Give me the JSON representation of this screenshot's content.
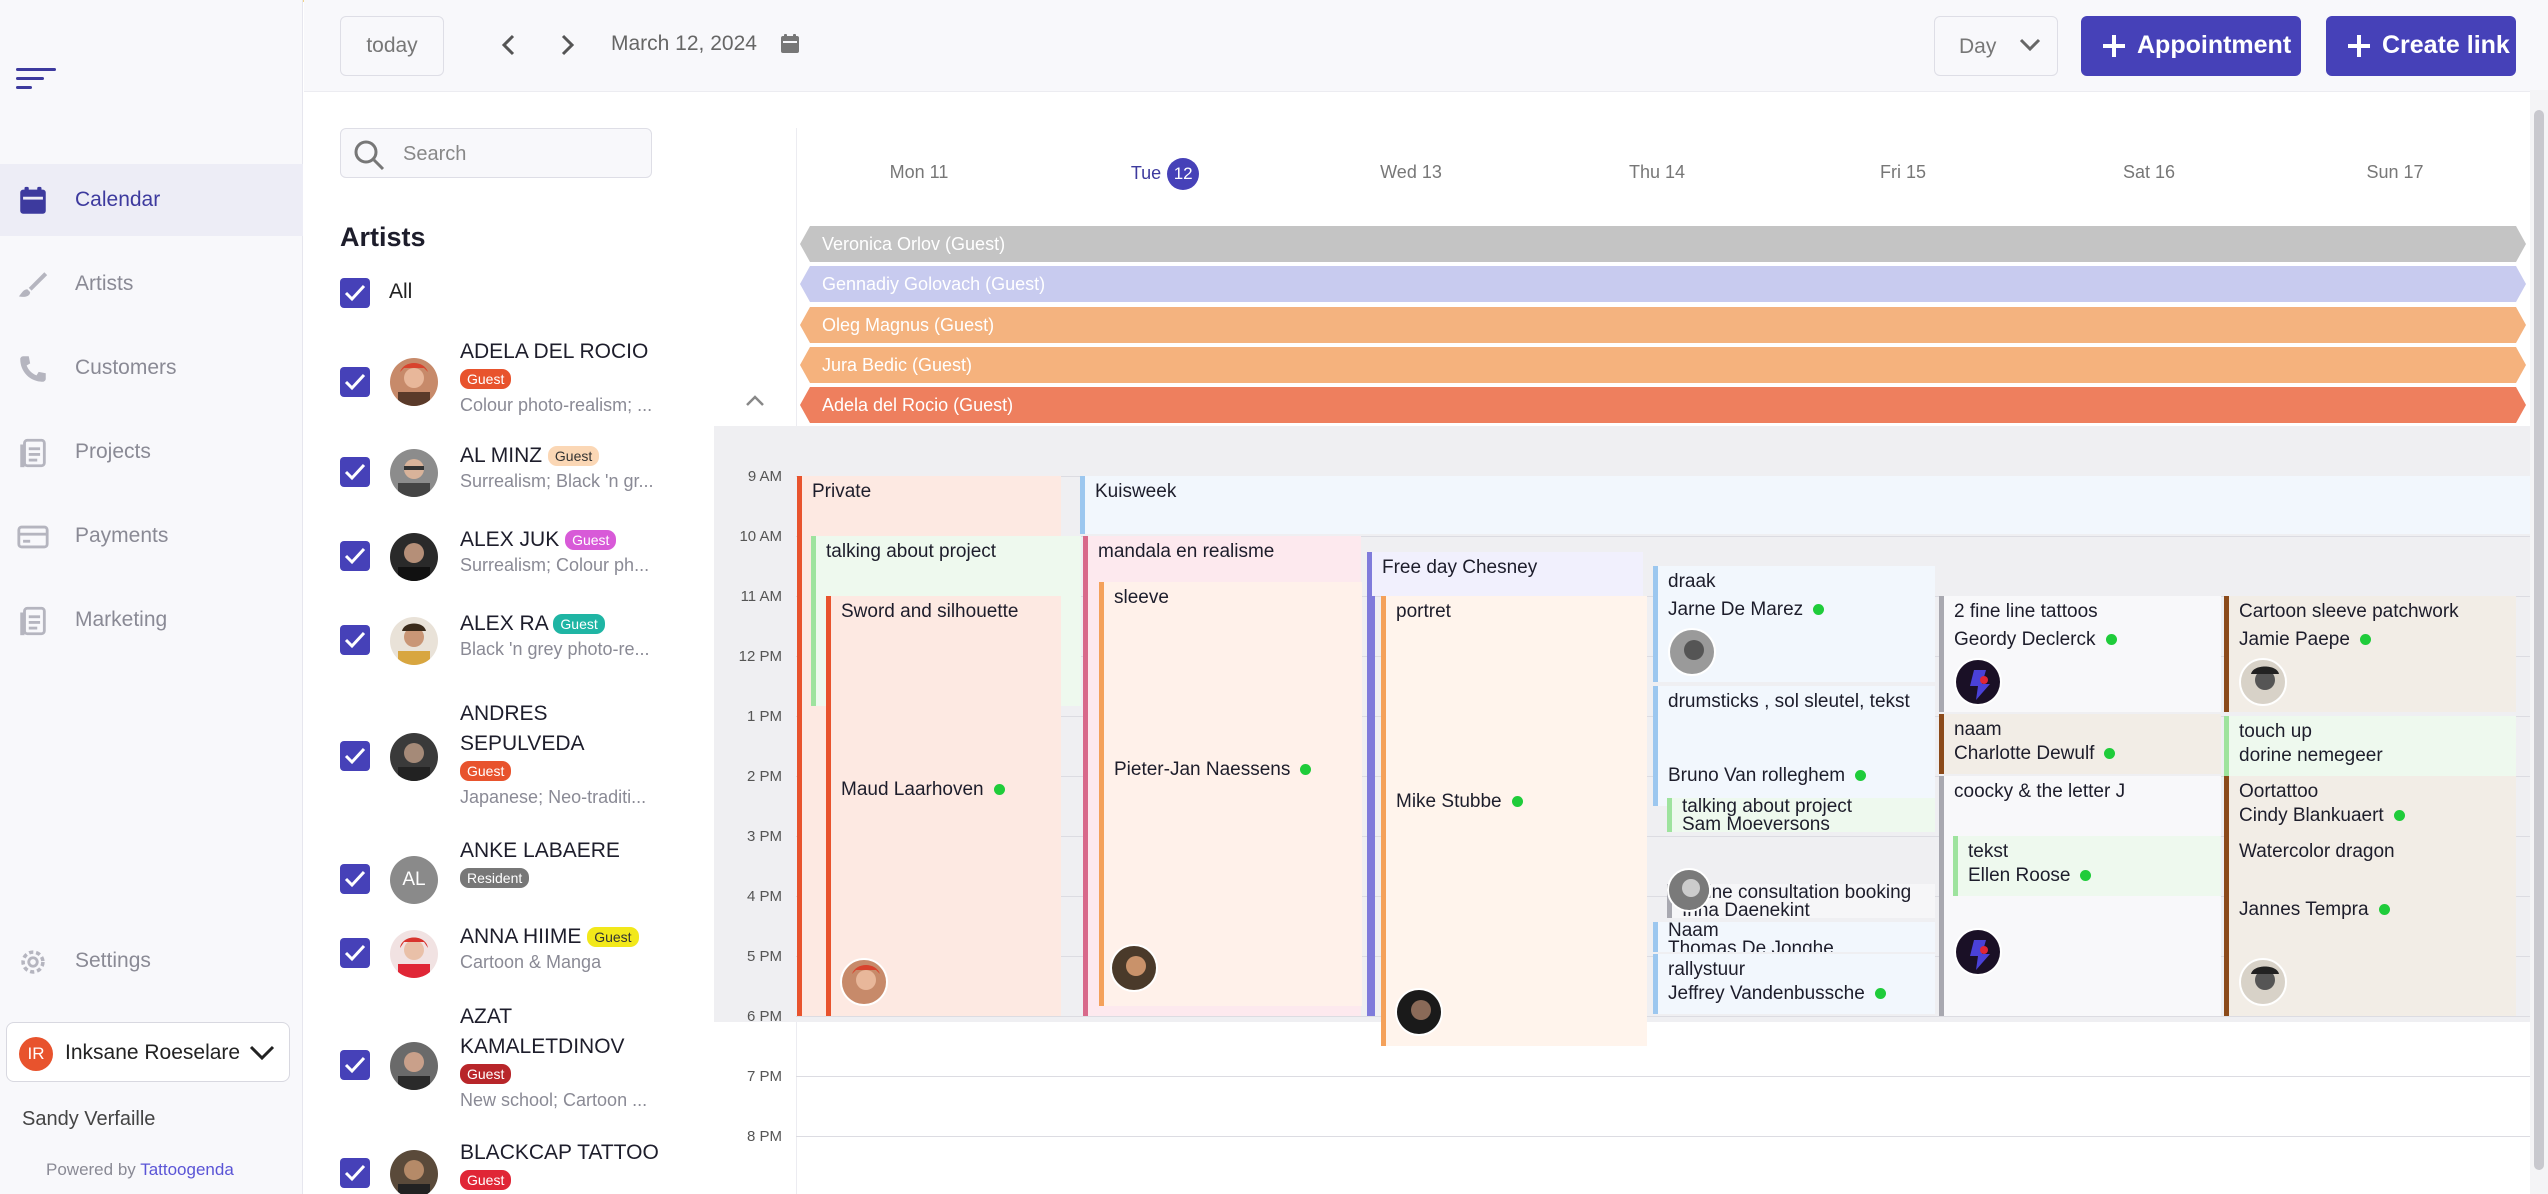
{
  "header": {
    "today_label": "today",
    "date": "March 12, 2024",
    "view": "Day",
    "appointment_label": "Appointment",
    "create_link_label": "Create link"
  },
  "sidebar": {
    "items": [
      {
        "label": "Calendar",
        "icon": "calendar-icon",
        "active": true
      },
      {
        "label": "Artists",
        "icon": "brush-icon"
      },
      {
        "label": "Customers",
        "icon": "phone-icon"
      },
      {
        "label": "Projects",
        "icon": "document-icon"
      },
      {
        "label": "Payments",
        "icon": "card-icon"
      },
      {
        "label": "Marketing",
        "icon": "document-icon"
      }
    ],
    "settings_label": "Settings",
    "studio_initials": "IR",
    "studio_name": "Inksane Roeselare",
    "user_name": "Sandy Verfaille",
    "powered_by": "Powered by",
    "brand": "Tattoogenda"
  },
  "artists": {
    "search_placeholder": "Search",
    "title": "Artists",
    "all_label": "All",
    "list": [
      {
        "name": "ADELA DEL ROCIO",
        "badge": "Guest",
        "badge_color": "#e8532d",
        "badge_text": "#ffffff",
        "styles": "Colour photo-realism; ..."
      },
      {
        "name": "AL MINZ",
        "badge": "Guest",
        "badge_color": "#fbd7b5",
        "badge_text": "#333333",
        "styles": "Surrealism; Black 'n gr..."
      },
      {
        "name": "ALEX JUK",
        "badge": "Guest",
        "badge_color": "#d85ad8",
        "badge_text": "#ffffff",
        "styles": "Surrealism; Colour ph..."
      },
      {
        "name": "ALEX RA",
        "badge": "Guest",
        "badge_color": "#1fb5a4",
        "badge_text": "#ffffff",
        "styles": "Black 'n grey photo-re..."
      },
      {
        "name_line1": "ANDRES",
        "name_line2": "SEPULVEDA",
        "badge": "Guest",
        "badge_color": "#e8532d",
        "badge_text": "#ffffff",
        "styles": "Japanese; Neo-traditi..."
      },
      {
        "name": "ANKE LABAERE",
        "initials": "AL",
        "badge": "Resident",
        "badge_color": "#777777",
        "badge_text": "#ffffff",
        "styles": ""
      },
      {
        "name": "ANNA HIIME",
        "badge": "Guest",
        "badge_color": "#f2e81a",
        "badge_text": "#333333",
        "styles": "Cartoon & Manga"
      },
      {
        "name_line1": "AZAT",
        "name_line2": "KAMALETDINOV",
        "badge": "Guest",
        "badge_color": "#b8262a",
        "badge_text": "#ffffff",
        "styles": "New school; Cartoon ..."
      },
      {
        "name": "BLACKCAP TATTOO",
        "badge": "Guest",
        "badge_color": "#e02636",
        "badge_text": "#ffffff",
        "styles": ""
      }
    ]
  },
  "calendar": {
    "days": [
      {
        "label": "Mon 11"
      },
      {
        "label": "Tue",
        "num": "12",
        "today": true
      },
      {
        "label": "Wed 13"
      },
      {
        "label": "Thu 14"
      },
      {
        "label": "Fri 15"
      },
      {
        "label": "Sat 16"
      },
      {
        "label": "Sun 17"
      }
    ],
    "times": [
      "9 AM",
      "10 AM",
      "11 AM",
      "12 PM",
      "1 PM",
      "2 PM",
      "3 PM",
      "4 PM",
      "5 PM",
      "6 PM",
      "7 PM",
      "8 PM"
    ],
    "all_day": [
      {
        "title": "Veronica Orlov (Guest)",
        "color": "#c4c4c4"
      },
      {
        "title": "Gennadiy Golovach (Guest)",
        "color": "#c8cbef"
      },
      {
        "title": "Oleg Magnus (Guest)",
        "color": "#f4b37f"
      },
      {
        "title": "Jura Bedic (Guest)",
        "color": "#f5b27d"
      },
      {
        "title": "Adela del Rocio (Guest)",
        "color": "#ee7f5e"
      }
    ],
    "events": {
      "private": "Private",
      "kuisweek": "Kuisweek",
      "talking_project": "talking about project",
      "sword": "Sword and silhouette",
      "sword_artist": "Maud Laarhoven",
      "mandala": "mandala en realisme",
      "sleeve": "sleeve",
      "sleeve_artist": "Pieter-Jan Naessens",
      "free_day": "Free day Chesney",
      "portret": "portret",
      "portret_artist": "Mike Stubbe",
      "draak": "draak",
      "draak_artist": "Jarne De Marez",
      "drumsticks": "drumsticks , sol sleutel, tekst",
      "drumsticks_artist": "Bruno Van rolleghem",
      "talking2": "talking about project",
      "talking2_artist": "Sam Moeversons",
      "online": "online consultation booking",
      "online_artist": "Irina Daenekint",
      "naam_thu": "Naam",
      "naam_thu_artist": "Thomas De Jonghe",
      "rallystuur": "rallystuur",
      "rallystuur_artist": "Jeffrey Vandenbussche",
      "fine_line": "2 fine line tattoos",
      "fine_line_artist": "Geordy Declerck",
      "naam_fri": "naam",
      "naam_fri_artist": "Charlotte Dewulf",
      "coocky": "coocky & the letter J",
      "tekst": "tekst",
      "tekst_artist": "Ellen Roose",
      "cartoon_sleeve": "Cartoon sleeve patchwork",
      "cartoon_sleeve_artist": "Jamie Paepe",
      "touch_up": "touch up",
      "touch_up_artist": "dorine nemegeer",
      "oortattoo": "Oortattoo",
      "oortattoo_artist": "Cindy Blankuaert",
      "watercolor": "Watercolor dragon",
      "watercolor_artist": "Jannes Tempra"
    }
  }
}
